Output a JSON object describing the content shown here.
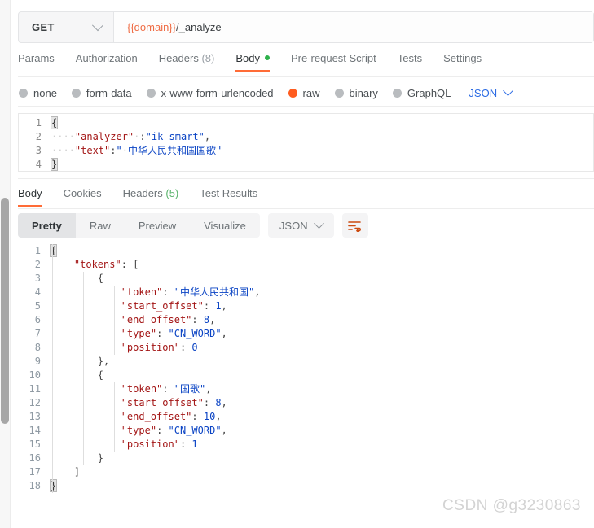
{
  "request": {
    "method": "GET",
    "method_caret": "chevron-down",
    "url_variable": "{{domain}}",
    "url_path": "/_analyze",
    "tabs": [
      {
        "label": "Params",
        "active": false
      },
      {
        "label": "Authorization",
        "active": false
      },
      {
        "label": "Headers",
        "count": "(8)",
        "active": false
      },
      {
        "label": "Body",
        "active": true,
        "dot": "green"
      },
      {
        "label": "Pre-request Script",
        "active": false
      },
      {
        "label": "Tests",
        "active": false
      },
      {
        "label": "Settings",
        "active": false
      }
    ],
    "body_types": [
      {
        "label": "none",
        "selected": false
      },
      {
        "label": "form-data",
        "selected": false
      },
      {
        "label": "x-www-form-urlencoded",
        "selected": false
      },
      {
        "label": "raw",
        "selected": true
      },
      {
        "label": "binary",
        "selected": false
      },
      {
        "label": "GraphQL",
        "selected": false
      }
    ],
    "format_label": "JSON",
    "body_lines": [
      {
        "num": "1",
        "tokens": [
          {
            "t": "{",
            "c": "brk"
          }
        ]
      },
      {
        "num": "2",
        "tokens": [
          {
            "t": "····",
            "c": "ws"
          },
          {
            "t": "\"analyzer\"",
            "c": "k"
          },
          {
            "t": "·",
            "c": "ws"
          },
          {
            "t": ":",
            "c": "p"
          },
          {
            "t": "\"ik_smart\"",
            "c": "s"
          },
          {
            "t": ",",
            "c": "p"
          }
        ]
      },
      {
        "num": "3",
        "tokens": [
          {
            "t": "····",
            "c": "ws"
          },
          {
            "t": "\"text\"",
            "c": "k"
          },
          {
            "t": ":",
            "c": "p"
          },
          {
            "t": "\"",
            "c": "s"
          },
          {
            "t": "·",
            "c": "ws"
          },
          {
            "t": "中华人民共和国国歌\"",
            "c": "s"
          }
        ]
      },
      {
        "num": "4",
        "tokens": [
          {
            "t": "}",
            "c": "brk"
          }
        ]
      }
    ]
  },
  "response": {
    "tabs": [
      {
        "label": "Body",
        "active": true
      },
      {
        "label": "Cookies",
        "active": false
      },
      {
        "label": "Headers",
        "count": "(5)",
        "active": false
      },
      {
        "label": "Test Results",
        "active": false
      }
    ],
    "view_modes": [
      {
        "label": "Pretty",
        "active": true
      },
      {
        "label": "Raw",
        "active": false
      },
      {
        "label": "Preview",
        "active": false
      },
      {
        "label": "Visualize",
        "active": false
      }
    ],
    "format_label": "JSON",
    "beautify_icon": "beautify-icon",
    "body_lines": [
      {
        "num": "1",
        "indent": 0,
        "tokens": [
          {
            "t": "{",
            "c": "brk"
          }
        ]
      },
      {
        "num": "2",
        "indent": 0,
        "tokens": [
          {
            "t": "    ",
            "c": "p"
          },
          {
            "t": "\"tokens\"",
            "c": "k"
          },
          {
            "t": ": ",
            "c": "p"
          },
          {
            "t": "[",
            "c": "p"
          }
        ]
      },
      {
        "num": "3",
        "indent": 1,
        "tokens": [
          {
            "t": "        ",
            "c": "p"
          },
          {
            "t": "{",
            "c": "p"
          }
        ]
      },
      {
        "num": "4",
        "indent": 2,
        "tokens": [
          {
            "t": "            ",
            "c": "p"
          },
          {
            "t": "\"token\"",
            "c": "k"
          },
          {
            "t": ": ",
            "c": "p"
          },
          {
            "t": "\"中华人民共和国\"",
            "c": "s"
          },
          {
            "t": ",",
            "c": "p"
          }
        ]
      },
      {
        "num": "5",
        "indent": 2,
        "tokens": [
          {
            "t": "            ",
            "c": "p"
          },
          {
            "t": "\"start_offset\"",
            "c": "k"
          },
          {
            "t": ": ",
            "c": "p"
          },
          {
            "t": "1",
            "c": "n"
          },
          {
            "t": ",",
            "c": "p"
          }
        ]
      },
      {
        "num": "6",
        "indent": 2,
        "tokens": [
          {
            "t": "            ",
            "c": "p"
          },
          {
            "t": "\"end_offset\"",
            "c": "k"
          },
          {
            "t": ": ",
            "c": "p"
          },
          {
            "t": "8",
            "c": "n"
          },
          {
            "t": ",",
            "c": "p"
          }
        ]
      },
      {
        "num": "7",
        "indent": 2,
        "tokens": [
          {
            "t": "            ",
            "c": "p"
          },
          {
            "t": "\"type\"",
            "c": "k"
          },
          {
            "t": ": ",
            "c": "p"
          },
          {
            "t": "\"CN_WORD\"",
            "c": "s"
          },
          {
            "t": ",",
            "c": "p"
          }
        ]
      },
      {
        "num": "8",
        "indent": 2,
        "tokens": [
          {
            "t": "            ",
            "c": "p"
          },
          {
            "t": "\"position\"",
            "c": "k"
          },
          {
            "t": ": ",
            "c": "p"
          },
          {
            "t": "0",
            "c": "n"
          }
        ]
      },
      {
        "num": "9",
        "indent": 1,
        "tokens": [
          {
            "t": "        ",
            "c": "p"
          },
          {
            "t": "}",
            "c": "p"
          },
          {
            "t": ",",
            "c": "p"
          }
        ]
      },
      {
        "num": "10",
        "indent": 1,
        "tokens": [
          {
            "t": "        ",
            "c": "p"
          },
          {
            "t": "{",
            "c": "p"
          }
        ]
      },
      {
        "num": "11",
        "indent": 2,
        "tokens": [
          {
            "t": "            ",
            "c": "p"
          },
          {
            "t": "\"token\"",
            "c": "k"
          },
          {
            "t": ": ",
            "c": "p"
          },
          {
            "t": "\"国歌\"",
            "c": "s"
          },
          {
            "t": ",",
            "c": "p"
          }
        ]
      },
      {
        "num": "12",
        "indent": 2,
        "tokens": [
          {
            "t": "            ",
            "c": "p"
          },
          {
            "t": "\"start_offset\"",
            "c": "k"
          },
          {
            "t": ": ",
            "c": "p"
          },
          {
            "t": "8",
            "c": "n"
          },
          {
            "t": ",",
            "c": "p"
          }
        ]
      },
      {
        "num": "13",
        "indent": 2,
        "tokens": [
          {
            "t": "            ",
            "c": "p"
          },
          {
            "t": "\"end_offset\"",
            "c": "k"
          },
          {
            "t": ": ",
            "c": "p"
          },
          {
            "t": "10",
            "c": "n"
          },
          {
            "t": ",",
            "c": "p"
          }
        ]
      },
      {
        "num": "14",
        "indent": 2,
        "tokens": [
          {
            "t": "            ",
            "c": "p"
          },
          {
            "t": "\"type\"",
            "c": "k"
          },
          {
            "t": ": ",
            "c": "p"
          },
          {
            "t": "\"CN_WORD\"",
            "c": "s"
          },
          {
            "t": ",",
            "c": "p"
          }
        ]
      },
      {
        "num": "15",
        "indent": 2,
        "tokens": [
          {
            "t": "            ",
            "c": "p"
          },
          {
            "t": "\"position\"",
            "c": "k"
          },
          {
            "t": ": ",
            "c": "p"
          },
          {
            "t": "1",
            "c": "n"
          }
        ]
      },
      {
        "num": "16",
        "indent": 1,
        "tokens": [
          {
            "t": "        ",
            "c": "p"
          },
          {
            "t": "}",
            "c": "p"
          }
        ]
      },
      {
        "num": "17",
        "indent": 0,
        "tokens": [
          {
            "t": "    ",
            "c": "p"
          },
          {
            "t": "]",
            "c": "p"
          }
        ]
      },
      {
        "num": "18",
        "indent": 0,
        "tokens": [
          {
            "t": "}",
            "c": "brk"
          }
        ]
      }
    ]
  },
  "watermark": "CSDN @g3230863",
  "colors": {
    "accent": "#ff6c37",
    "green": "#2db14b",
    "blue": "#2b6be4",
    "url_variable": "#ef6c44"
  }
}
